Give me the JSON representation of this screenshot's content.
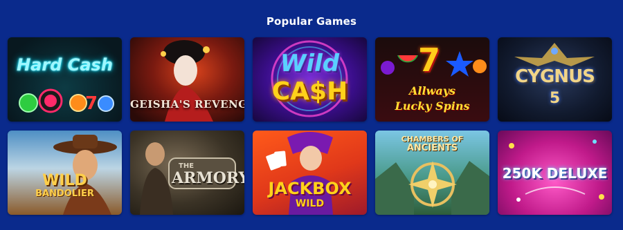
{
  "section": {
    "title": "Popular Games"
  },
  "games": [
    {
      "id": "hard-cash",
      "lines": [
        "Hard Cash"
      ]
    },
    {
      "id": "geishas-revenge",
      "lines": [
        "GEISHA'S REVENGE"
      ]
    },
    {
      "id": "wild-cash",
      "lines": [
        "Wild",
        "CA$H"
      ]
    },
    {
      "id": "allways-lucky-spins",
      "lines": [
        "Allways",
        "Lucky Spins"
      ],
      "symbol": "7"
    },
    {
      "id": "cygnus-5",
      "lines": [
        "CYGNUS",
        "5"
      ]
    },
    {
      "id": "wild-bandolier",
      "lines": [
        "WILD",
        "BANDOLIER"
      ]
    },
    {
      "id": "the-armory",
      "lines": [
        "THE",
        "ARMORY"
      ]
    },
    {
      "id": "jackbox-wild",
      "lines": [
        "JACKBOX",
        "WILD"
      ]
    },
    {
      "id": "chambers-of-ancients",
      "lines": [
        "CHAMBERS OF",
        "ANCIENTS"
      ]
    },
    {
      "id": "250k-deluxe",
      "lines": [
        "250K DELUXE"
      ]
    }
  ],
  "colors": {
    "page_background": "#0a2a8c",
    "title_text": "#ffffff"
  }
}
